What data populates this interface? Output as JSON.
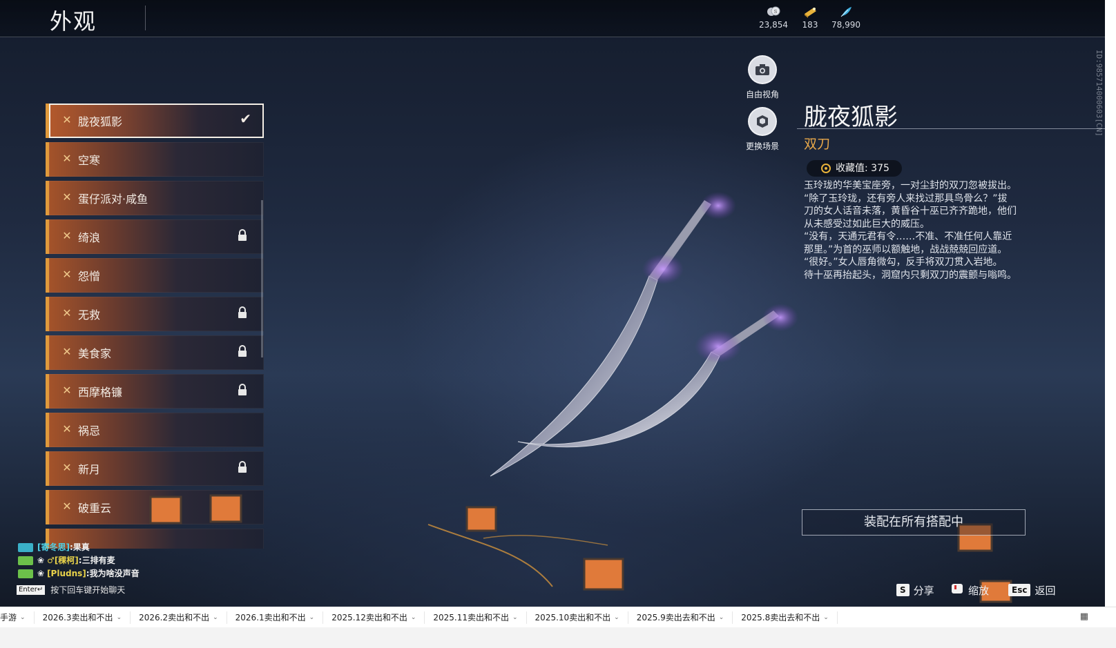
{
  "header": {
    "title": "外观",
    "currencies": [
      {
        "icon": "coin-stack-icon",
        "value": "23,854"
      },
      {
        "icon": "gold-ticket-icon",
        "value": "183"
      },
      {
        "icon": "feather-icon",
        "value": "78,990"
      }
    ],
    "vertical_id": "ID:985714000603[CN]"
  },
  "skins": [
    {
      "label": "胧夜狐影",
      "locked": false,
      "selected": true
    },
    {
      "label": "空寒",
      "locked": false,
      "selected": false
    },
    {
      "label": "蛋仔派对·咸鱼",
      "locked": false,
      "selected": false
    },
    {
      "label": "绮浪",
      "locked": true,
      "selected": false
    },
    {
      "label": "怨憎",
      "locked": false,
      "selected": false
    },
    {
      "label": "无救",
      "locked": true,
      "selected": false
    },
    {
      "label": "美食家",
      "locked": true,
      "selected": false
    },
    {
      "label": "西摩格镰",
      "locked": true,
      "selected": false
    },
    {
      "label": "祸忌",
      "locked": false,
      "selected": false
    },
    {
      "label": "新月",
      "locked": true,
      "selected": false
    },
    {
      "label": "破重云",
      "locked": false,
      "selected": false
    }
  ],
  "view_buttons": {
    "free_view": "自由视角",
    "change_scene": "更换场景"
  },
  "detail": {
    "name": "胧夜狐影",
    "type": "双刀",
    "collect_label": "收藏值: 375",
    "description": [
      "玉玲珑的华美宝座旁，一对尘封的双刀忽被拔出。",
      "“除了玉玲珑，还有旁人来找过那具鸟骨么？”拔",
      "刀的女人话音未落，黄昏谷十巫已齐齐跪地，他们",
      "从未感受过如此巨大的威压。",
      "“没有，天通元君有令……不准、不准任何人靠近",
      "那里。”为首的巫师以额触地，战战兢兢回应道。",
      "“很好。”女人唇角微勾，反手将双刀贯入岩地。",
      "待十巫再抬起头，洞窟内只剩双刀的震颤与嗡鸣。"
    ],
    "equip_button": "装配在所有搭配中"
  },
  "hints": {
    "share_key": "S",
    "share_label": "分享",
    "zoom_label": "缩放",
    "back_key": "Esc",
    "back_label": "返回"
  },
  "chat": {
    "lines": [
      {
        "name": "[寄冬思]",
        "text": ":果真",
        "badge_color": "#3ab0c8",
        "name_color": "cyan"
      },
      {
        "name": "♂[稞柯]",
        "text": ":三排有麦",
        "badge_color": "#6cc04a",
        "name_color": "yellow"
      },
      {
        "name": "[Pludns]",
        "text": ":我为啥没声音",
        "badge_color": "#6cc04a",
        "name_color": "yellow"
      }
    ],
    "input_key": "Enter↵",
    "input_hint": "按下回车键开始聊天"
  },
  "taskbar": {
    "tabs": [
      "手游",
      "2026.3卖出和不出",
      "2026.2卖出和不出",
      "2026.1卖出和不出",
      "2025.12卖出和不出",
      "2025.11卖出和不出",
      "2025.10卖出和不出",
      "2025.9卖出去和不出",
      "2025.8卖出去和不出"
    ]
  },
  "colors": {
    "accent_orange": "#e09a3c",
    "type_gold": "#e8a84a",
    "chat_cyan": "#4fd0e6",
    "chat_yellow": "#e8d24a"
  }
}
